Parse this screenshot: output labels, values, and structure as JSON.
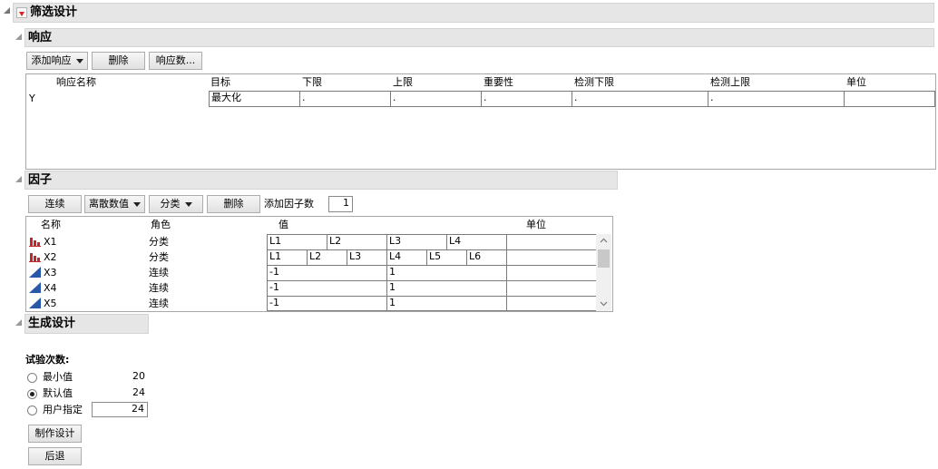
{
  "screening_design": {
    "title": "筛选设计"
  },
  "responses": {
    "title": "响应",
    "buttons": {
      "add_response": "添加响应",
      "delete": "删除",
      "num_responses": "响应数..."
    },
    "columns": [
      "响应名称",
      "目标",
      "下限",
      "上限",
      "重要性",
      "检测下限",
      "检测上限",
      "单位"
    ],
    "rows": [
      {
        "name": "Y",
        "goal": "最大化",
        "lower": ".",
        "upper": ".",
        "importance": ".",
        "detect_lower": ".",
        "detect_upper": ".",
        "unit": ""
      }
    ]
  },
  "factors": {
    "title": "因子",
    "buttons": {
      "continuous": "连续",
      "discrete_numeric": "离散数值",
      "categorical": "分类",
      "delete": "删除"
    },
    "add_factor_label": "添加因子数",
    "add_factor_count": "1",
    "columns": [
      "名称",
      "角色",
      "值",
      "单位"
    ],
    "rows": [
      {
        "name": "X1",
        "role": "分类",
        "icon": "categorical-icon",
        "values": [
          "L1",
          "L2",
          "L3",
          "L4"
        ]
      },
      {
        "name": "X2",
        "role": "分类",
        "icon": "categorical-icon",
        "values": [
          "L1",
          "L2",
          "L3",
          "L4",
          "L5",
          "L6"
        ]
      },
      {
        "name": "X3",
        "role": "连续",
        "icon": "continuous-icon",
        "values": [
          "-1",
          "1"
        ]
      },
      {
        "name": "X4",
        "role": "连续",
        "icon": "continuous-icon",
        "values": [
          "-1",
          "1"
        ]
      },
      {
        "name": "X5",
        "role": "连续",
        "icon": "continuous-icon",
        "values": [
          "-1",
          "1"
        ]
      }
    ]
  },
  "generate": {
    "title": "生成设计",
    "runs_label": "试验次数:",
    "options": [
      {
        "label": "最小值",
        "value": "20",
        "checked": false
      },
      {
        "label": "默认值",
        "value": "24",
        "checked": true
      },
      {
        "label": "用户指定",
        "value": "24",
        "checked": false
      }
    ],
    "buttons": {
      "make_design": "制作设计",
      "back": "后退"
    }
  },
  "colors": {
    "section_bar": "#e6e6e6",
    "red_triangle": "#e02020",
    "cat_icon": "#c0282c",
    "cont_icon": "#2a58a8"
  }
}
